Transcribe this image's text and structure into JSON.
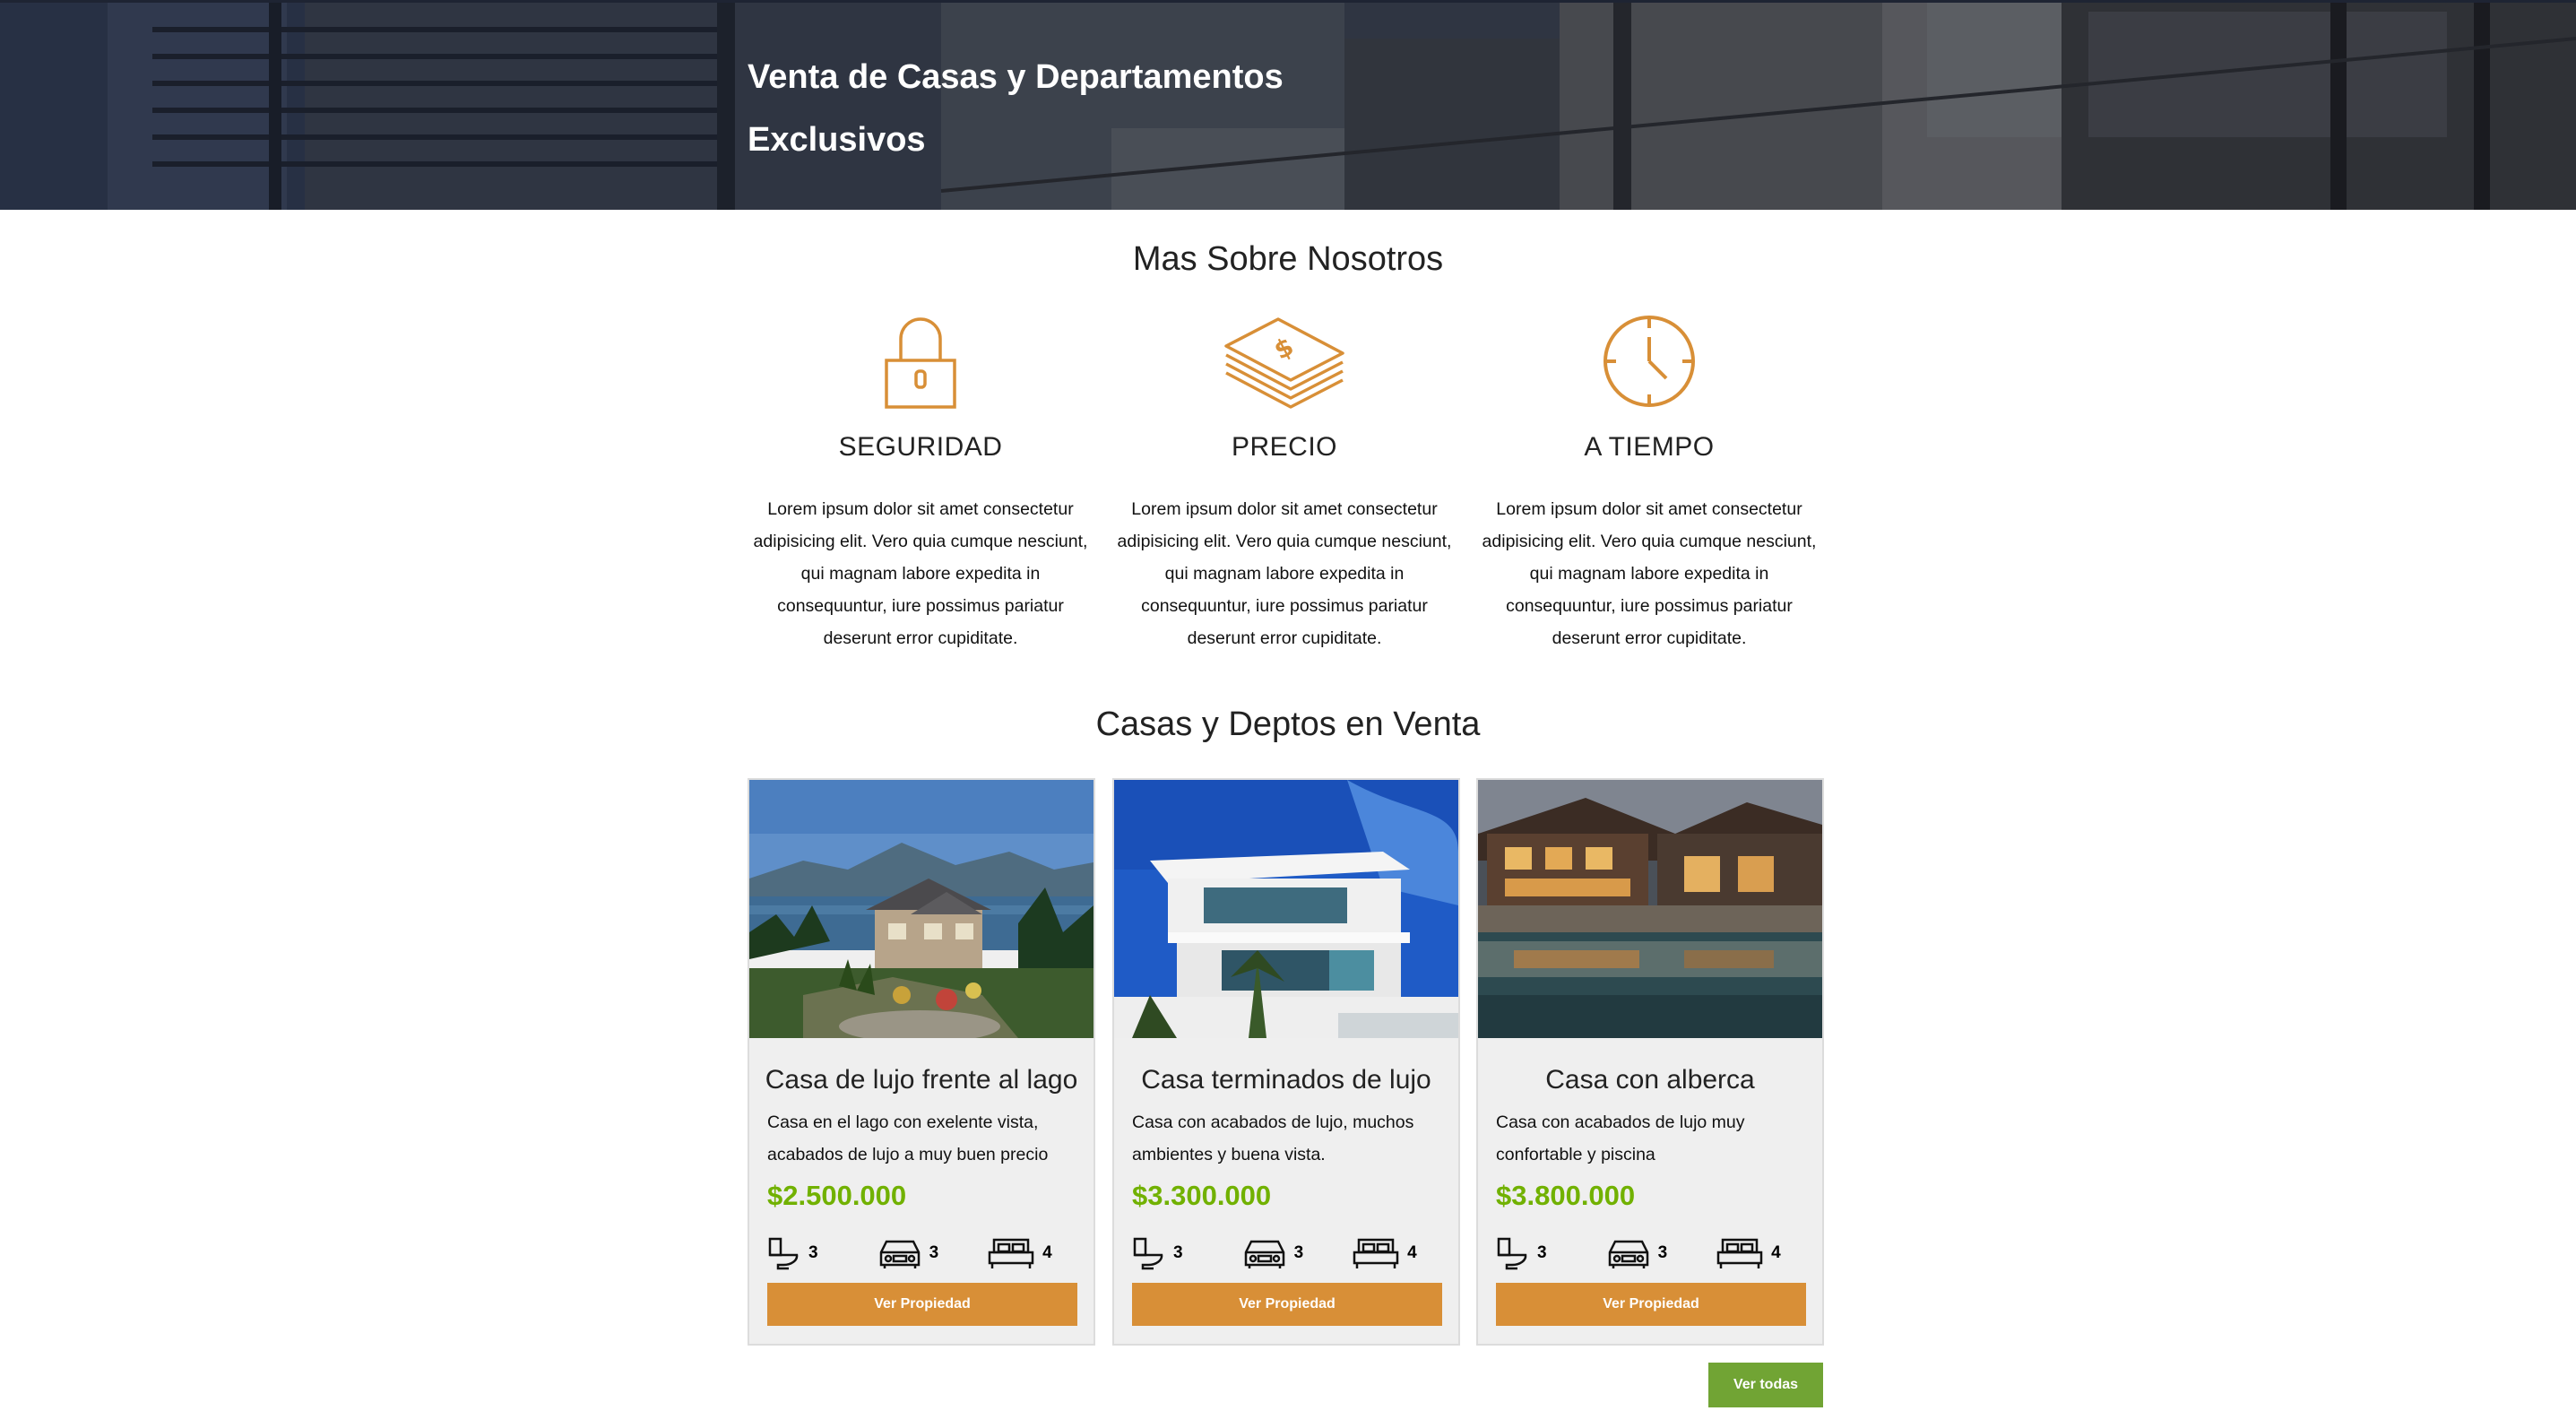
{
  "hero": {
    "title_line1": "Venta de Casas y Departamentos",
    "title_line2": "Exclusivos"
  },
  "about": {
    "title": "Mas Sobre Nosotros",
    "features": [
      {
        "icon": "lock-icon",
        "title": "SEGURIDAD",
        "text": "Lorem ipsum dolor sit amet consectetur adipisicing elit. Vero quia cumque nesciunt, qui magnam labore expedita in consequuntur, iure possimus pariatur deserunt error cupiditate."
      },
      {
        "icon": "money-icon",
        "title": "PRECIO",
        "text": "Lorem ipsum dolor sit amet consectetur adipisicing elit. Vero quia cumque nesciunt, qui magnam labore expedita in consequuntur, iure possimus pariatur deserunt error cupiditate."
      },
      {
        "icon": "clock-icon",
        "title": "A TIEMPO",
        "text": "Lorem ipsum dolor sit amet consectetur adipisicing elit. Vero quia cumque nesciunt, qui magnam labore expedita in consequuntur, iure possimus pariatur deserunt error cupiditate."
      }
    ]
  },
  "listings": {
    "title": "Casas y Deptos en Venta",
    "cards": [
      {
        "title": "Casa de lujo frente al lago",
        "desc": "Casa en el lago con exelente vista, acabados de lujo a muy buen precio",
        "price": "$2.500.000",
        "baths": "3",
        "parking": "3",
        "rooms": "4",
        "button": "Ver Propiedad"
      },
      {
        "title": "Casa terminados de lujo",
        "desc": "Casa con acabados de lujo, muchos ambientes y buena vista.",
        "price": "$3.300.000",
        "baths": "3",
        "parking": "3",
        "rooms": "4",
        "button": "Ver Propiedad"
      },
      {
        "title": "Casa con alberca",
        "desc": "Casa con acabados de lujo muy confortable y piscina",
        "price": "$3.800.000",
        "baths": "3",
        "parking": "3",
        "rooms": "4",
        "button": "Ver Propiedad"
      }
    ],
    "view_all": "Ver todas"
  },
  "colors": {
    "accent": "#d88f37",
    "price": "#71b100",
    "view_all": "#71a434"
  }
}
